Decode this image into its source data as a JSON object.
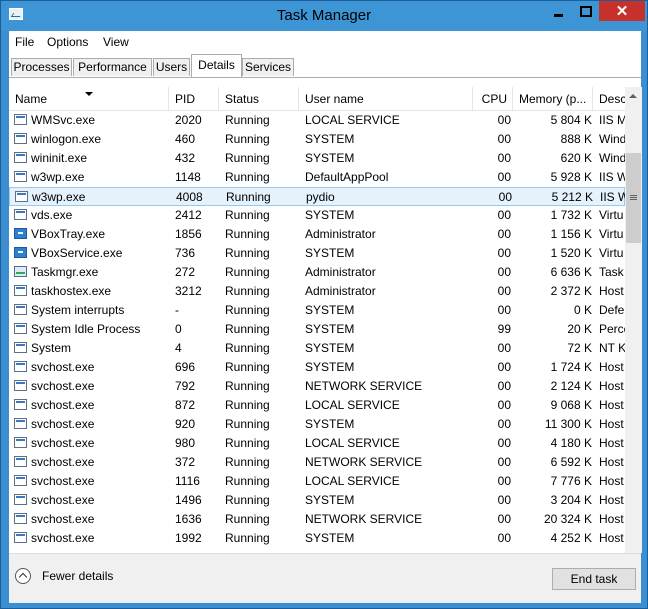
{
  "window": {
    "title": "Task Manager"
  },
  "menu": [
    "File",
    "Options",
    "View"
  ],
  "tabs": [
    "Processes",
    "Performance",
    "Users",
    "Details",
    "Services"
  ],
  "active_tab": "Details",
  "columns": [
    "Name",
    "PID",
    "Status",
    "User name",
    "CPU",
    "Memory (p...",
    "Desc"
  ],
  "sort_column": "Name",
  "selected_row": "w3wp.exe (4008)",
  "rows": [
    {
      "name": "WMSvc.exe",
      "pid": "2020",
      "status": "Running",
      "user": "LOCAL SERVICE",
      "cpu": "00",
      "mem": "5 804 K",
      "desc": "IIS M",
      "icon": "service-icon"
    },
    {
      "name": "winlogon.exe",
      "pid": "460",
      "status": "Running",
      "user": "SYSTEM",
      "cpu": "00",
      "mem": "888 K",
      "desc": "Wind",
      "icon": "process-icon"
    },
    {
      "name": "wininit.exe",
      "pid": "432",
      "status": "Running",
      "user": "SYSTEM",
      "cpu": "00",
      "mem": "620 K",
      "desc": "Wind",
      "icon": "process-icon"
    },
    {
      "name": "w3wp.exe",
      "pid": "1148",
      "status": "Running",
      "user": "DefaultAppPool",
      "cpu": "00",
      "mem": "5 928 K",
      "desc": "IIS W",
      "icon": "process-icon"
    },
    {
      "name": "w3wp.exe",
      "pid": "4008",
      "status": "Running",
      "user": "pydio",
      "cpu": "00",
      "mem": "5 212 K",
      "desc": "IIS W",
      "icon": "process-icon"
    },
    {
      "name": "vds.exe",
      "pid": "2412",
      "status": "Running",
      "user": "SYSTEM",
      "cpu": "00",
      "mem": "1 732 K",
      "desc": "Virtu",
      "icon": "process-icon"
    },
    {
      "name": "VBoxTray.exe",
      "pid": "1856",
      "status": "Running",
      "user": "Administrator",
      "cpu": "00",
      "mem": "1 156 K",
      "desc": "Virtu",
      "icon": "virtualbox-icon"
    },
    {
      "name": "VBoxService.exe",
      "pid": "736",
      "status": "Running",
      "user": "SYSTEM",
      "cpu": "00",
      "mem": "1 520 K",
      "desc": "Virtu",
      "icon": "virtualbox-icon"
    },
    {
      "name": "Taskmgr.exe",
      "pid": "272",
      "status": "Running",
      "user": "Administrator",
      "cpu": "00",
      "mem": "6 636 K",
      "desc": "Task",
      "icon": "task-manager-icon"
    },
    {
      "name": "taskhostex.exe",
      "pid": "3212",
      "status": "Running",
      "user": "Administrator",
      "cpu": "00",
      "mem": "2 372 K",
      "desc": "Host",
      "icon": "process-icon"
    },
    {
      "name": "System interrupts",
      "pid": "-",
      "status": "Running",
      "user": "SYSTEM",
      "cpu": "00",
      "mem": "0 K",
      "desc": "Defe",
      "icon": "process-icon"
    },
    {
      "name": "System Idle Process",
      "pid": "0",
      "status": "Running",
      "user": "SYSTEM",
      "cpu": "99",
      "mem": "20 K",
      "desc": "Perce",
      "icon": "process-icon"
    },
    {
      "name": "System",
      "pid": "4",
      "status": "Running",
      "user": "SYSTEM",
      "cpu": "00",
      "mem": "72 K",
      "desc": "NT K",
      "icon": "process-icon"
    },
    {
      "name": "svchost.exe",
      "pid": "696",
      "status": "Running",
      "user": "SYSTEM",
      "cpu": "00",
      "mem": "1 724 K",
      "desc": "Host",
      "icon": "process-icon"
    },
    {
      "name": "svchost.exe",
      "pid": "792",
      "status": "Running",
      "user": "NETWORK SERVICE",
      "cpu": "00",
      "mem": "2 124 K",
      "desc": "Host",
      "icon": "process-icon"
    },
    {
      "name": "svchost.exe",
      "pid": "872",
      "status": "Running",
      "user": "LOCAL SERVICE",
      "cpu": "00",
      "mem": "9 068 K",
      "desc": "Host",
      "icon": "process-icon"
    },
    {
      "name": "svchost.exe",
      "pid": "920",
      "status": "Running",
      "user": "SYSTEM",
      "cpu": "00",
      "mem": "11 300 K",
      "desc": "Host",
      "icon": "process-icon"
    },
    {
      "name": "svchost.exe",
      "pid": "980",
      "status": "Running",
      "user": "LOCAL SERVICE",
      "cpu": "00",
      "mem": "4 180 K",
      "desc": "Host",
      "icon": "process-icon"
    },
    {
      "name": "svchost.exe",
      "pid": "372",
      "status": "Running",
      "user": "NETWORK SERVICE",
      "cpu": "00",
      "mem": "6 592 K",
      "desc": "Host",
      "icon": "process-icon"
    },
    {
      "name": "svchost.exe",
      "pid": "1116",
      "status": "Running",
      "user": "LOCAL SERVICE",
      "cpu": "00",
      "mem": "7 776 K",
      "desc": "Host",
      "icon": "process-icon"
    },
    {
      "name": "svchost.exe",
      "pid": "1496",
      "status": "Running",
      "user": "SYSTEM",
      "cpu": "00",
      "mem": "3 204 K",
      "desc": "Host",
      "icon": "process-icon"
    },
    {
      "name": "svchost.exe",
      "pid": "1636",
      "status": "Running",
      "user": "NETWORK SERVICE",
      "cpu": "00",
      "mem": "20 324 K",
      "desc": "Host",
      "icon": "process-icon"
    },
    {
      "name": "svchost.exe",
      "pid": "1992",
      "status": "Running",
      "user": "SYSTEM",
      "cpu": "00",
      "mem": "4 252 K",
      "desc": "Host",
      "icon": "process-icon"
    }
  ],
  "footer": {
    "fewer_details": "Fewer details",
    "end_task": "End task"
  }
}
